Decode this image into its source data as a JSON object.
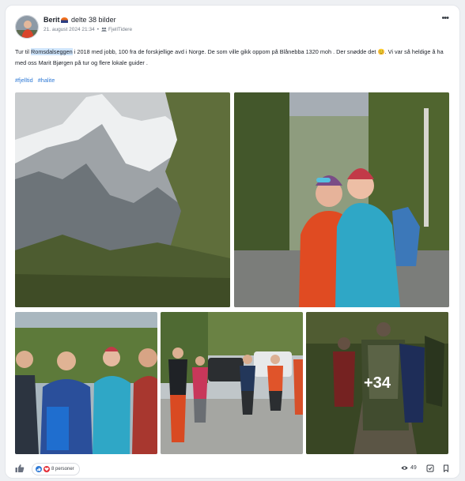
{
  "post": {
    "author": "Berit",
    "author_icon": "flag-icon",
    "action": "delte 38 bilder",
    "date": "21. august 2024 21:34",
    "group": "FjellTidere",
    "text_before": "Tur til ",
    "text_highlight": "Romsdalseggen",
    "text_after": " i 2018 med jobb, 100 fra de forskjellige avd i Norge. De som ville gikk oppom på Blånebba 1320 moh . Der snødde det 😊. Vi var så heldige å ha med oss Marit Bjørgen på tur og flere lokale guider .",
    "hashtags": [
      "#fjelltid",
      "#halite"
    ]
  },
  "gallery": {
    "more_label": "+34",
    "photos": [
      {
        "subject": "snowy-mountain-peak"
      },
      {
        "subject": "two-women-hikers"
      },
      {
        "subject": "hiking-group-selfie"
      },
      {
        "subject": "group-at-parking-lot"
      },
      {
        "subject": "hikers-on-trail"
      }
    ]
  },
  "footer": {
    "reactions_label": "8 personer",
    "views": "49",
    "icons": [
      "thumbs-up-icon",
      "eye-icon",
      "checkbox-icon",
      "bookmark-icon"
    ]
  },
  "colors": {
    "link": "#2f7ad6",
    "highlight": "#cfe5fb",
    "like_blue": "#2f7ad6",
    "heart_red": "#e4303a"
  }
}
